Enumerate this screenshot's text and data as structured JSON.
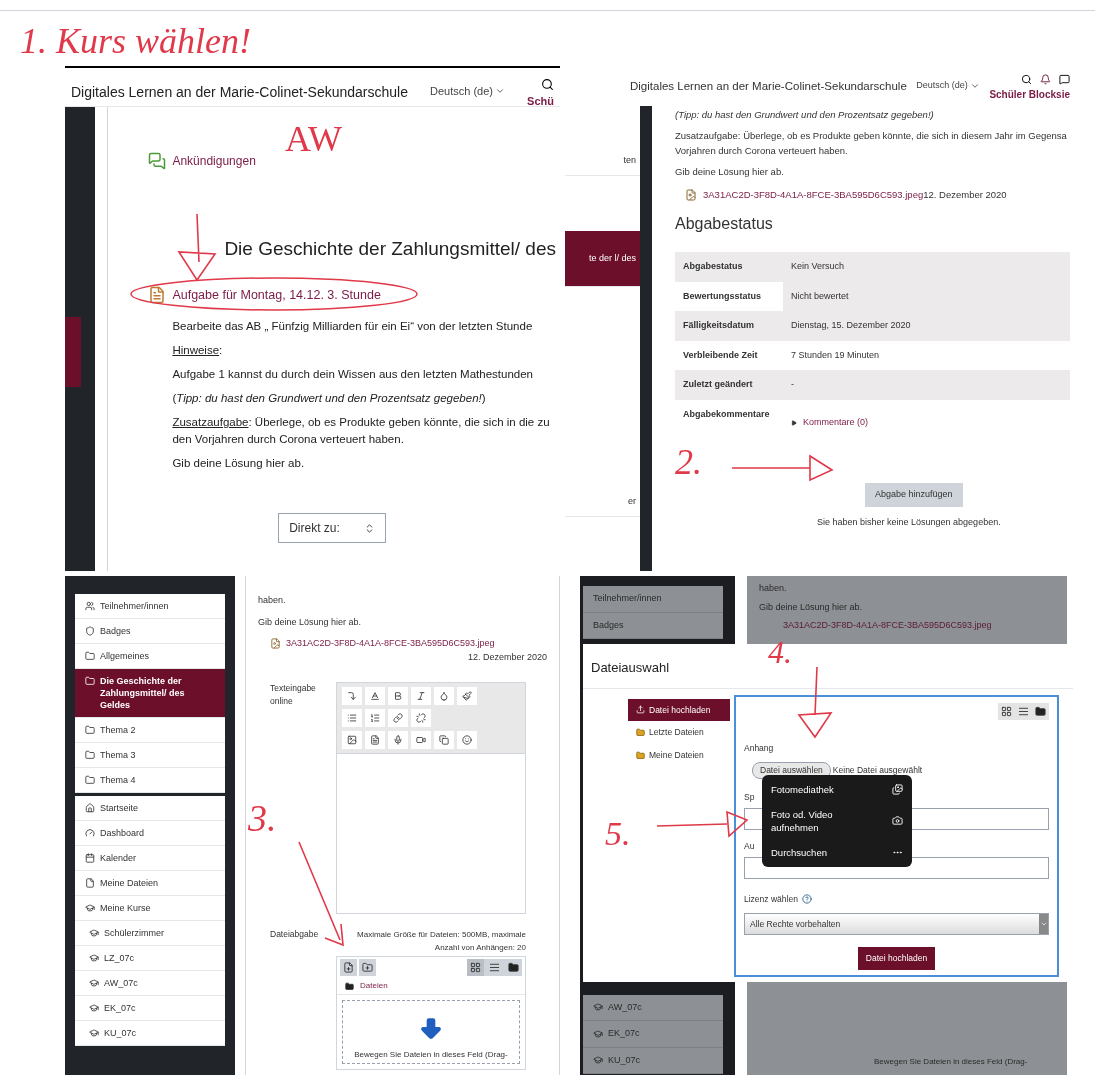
{
  "title_note": "1. Kurs wählen!",
  "panel_course": {
    "header": {
      "site_title": "Digitales Lernen an der Marie-Colinet-Sekundarschule",
      "language": "Deutsch (de)",
      "user": "Schü"
    },
    "annotation": "AW",
    "announcements": "Ankündigungen",
    "section_title": "Die Geschichte der Zahlungsmittel/ des",
    "assignment_link": "Aufgabe für Montag, 14.12. 3. Stunde",
    "paragraphs": [
      {
        "kind": "plain",
        "text": "Bearbeite das AB „ Fünfzig Milliarden für ein Ei“ von der letzten Stunde"
      },
      {
        "kind": "labeled",
        "label": "Hinweise",
        "text": ":"
      },
      {
        "kind": "plain",
        "text": "Aufgabe 1 kannst du durch dein Wissen aus den letzten Mathestunden"
      },
      {
        "kind": "plain",
        "text": "(*Tipp: du hast den Grundwert und den Prozentsatz gegeben!*)"
      },
      {
        "kind": "labeled",
        "label": "Zusatzaufgabe",
        "text": ": Überlege, ob es Produkte geben könnte, die sich in die zu den Vorjahren durch Corona verteuert haben."
      },
      {
        "kind": "plain",
        "text": "Gib deine Lösung hier ab."
      }
    ],
    "jump_select": "Direkt zu:"
  },
  "panel_status": {
    "header": {
      "site_title": "Digitales Lernen an der Marie-Colinet-Sekundarschule",
      "language": "Deutsch (de)",
      "user": "Schüler Blocksie"
    },
    "sidebar": [
      {
        "text": "ten",
        "selected": false
      },
      {
        "text": "te der l/ des",
        "selected": true
      },
      {
        "text": "er",
        "selected": false
      }
    ],
    "lines": [
      {
        "kind": "italic",
        "text": "(Tipp: du hast den Grundwert und den Prozentsatz gegeben!)"
      },
      {
        "kind": "plain",
        "text": "Zusatzaufgabe: Überlege, ob es Produkte geben könnte, die sich in diesem Jahr im Gegensa"
      },
      {
        "kind": "plain",
        "text": "Vorjahren durch Corona verteuert haben."
      },
      {
        "kind": "plain",
        "text": "Gib deine Lösung hier ab."
      }
    ],
    "file": {
      "name": "3A31AC2D-3F8D-4A1A-8FCE-3BA595D6C593.jpeg",
      "date": "12. Dezember 2020"
    },
    "heading": "Abgabestatus",
    "table": [
      {
        "label": "Abgabestatus",
        "value": "Kein Versuch",
        "kind": "text"
      },
      {
        "label": "Bewertungsstatus",
        "value": "Nicht bewertet",
        "kind": "text"
      },
      {
        "label": "Fälligkeitsdatum",
        "value": "Dienstag, 15. Dezember 2020",
        "kind": "text"
      },
      {
        "label": "Verbleibende Zeit",
        "value": "7 Stunden 19 Minuten",
        "kind": "text"
      },
      {
        "label": "Zuletzt geändert",
        "value": "-",
        "kind": "text"
      },
      {
        "label": "Abgabekommentare",
        "value": "Kommentare (0)",
        "kind": "link"
      }
    ],
    "annotation": "2.",
    "button": "Abgabe hinzufügen",
    "note": "Sie haben bisher keine Lösungen abgegeben."
  },
  "panel_submission": {
    "sidebar": [
      {
        "items": [
          {
            "label": "Teilnehmer/innen",
            "selected": false
          },
          {
            "label": "Badges",
            "selected": false
          },
          {
            "label": "Allgemeines",
            "selected": false
          },
          {
            "label": "Die Geschichte der Zahlungsmittel/ des Geldes",
            "selected": true
          },
          {
            "label": "Thema 2",
            "selected": false
          },
          {
            "label": "Thema 3",
            "selected": false
          },
          {
            "label": "Thema 4",
            "selected": false
          }
        ]
      },
      {
        "items": [
          {
            "label": "Startseite",
            "selected": false
          },
          {
            "label": "Dashboard",
            "selected": false
          },
          {
            "label": "Kalender",
            "selected": false
          },
          {
            "label": "Meine Dateien",
            "selected": false
          },
          {
            "label": "Meine Kurse",
            "selected": false,
            "children": [
              {
                "label": "Schülerzimmer",
                "selected": false
              },
              {
                "label": "LZ_07c",
                "selected": false
              },
              {
                "label": "AW_07c",
                "selected": false
              },
              {
                "label": "EK_07c",
                "selected": false
              },
              {
                "label": "KU_07c",
                "selected": false
              }
            ]
          }
        ]
      }
    ],
    "lines": [
      "haben.",
      "Gib deine Lösung hier ab."
    ],
    "file": {
      "name": "3A31AC2D-3F8D-4A1A-8FCE-3BA595D6C593.jpeg",
      "date": "12. Dezember 2020"
    },
    "text_label": "Texteingabe online",
    "file_label": "Dateiabgabe",
    "file_limits": "Maximale Größe für Dateien: 500MB, maximale Anzahl von Anhängen: 20",
    "folder": "Dateien",
    "drop_text": "Bewegen Sie Dateien in dieses Feld (Drag-",
    "annotation": "3."
  },
  "panel_filepicker": {
    "background": {
      "sidebar_top": [
        "Teilnehmer/innen",
        "Badges"
      ],
      "sidebar_bottom": [
        "AW_07c",
        "EK_07c",
        "KU_07c"
      ],
      "lines": [
        "haben.",
        "Gib deine Lösung hier ab."
      ],
      "file": "3A31AC2D-3F8D-4A1A-8FCE-3BA595D6C593.jpeg",
      "drop_text": "Bewegen Sie Dateien in dieses Feld (Drag-"
    },
    "dialog": {
      "title": "Dateiauswahl",
      "repositories": [
        {
          "label": "Datei hochladen",
          "selected": true
        },
        {
          "label": "Letzte Dateien",
          "selected": false
        },
        {
          "label": "Meine Dateien",
          "selected": false
        }
      ],
      "attachment_label": "Anhang",
      "choose_button": "Datei auswählen",
      "no_file": "Keine Datei ausgewählt",
      "menu": [
        {
          "label": "Fotomediathek"
        },
        {
          "label": "Foto od. Video aufnehmen"
        },
        {
          "label": "Durchsuchen"
        }
      ],
      "field_labels": [
        "Sp",
        "Au"
      ],
      "license_label": "Lizenz wählen",
      "license_value": "Alle Rechte vorbehalten",
      "upload_button": "Datei hochladen"
    },
    "annotations": [
      "4.",
      "5."
    ]
  }
}
